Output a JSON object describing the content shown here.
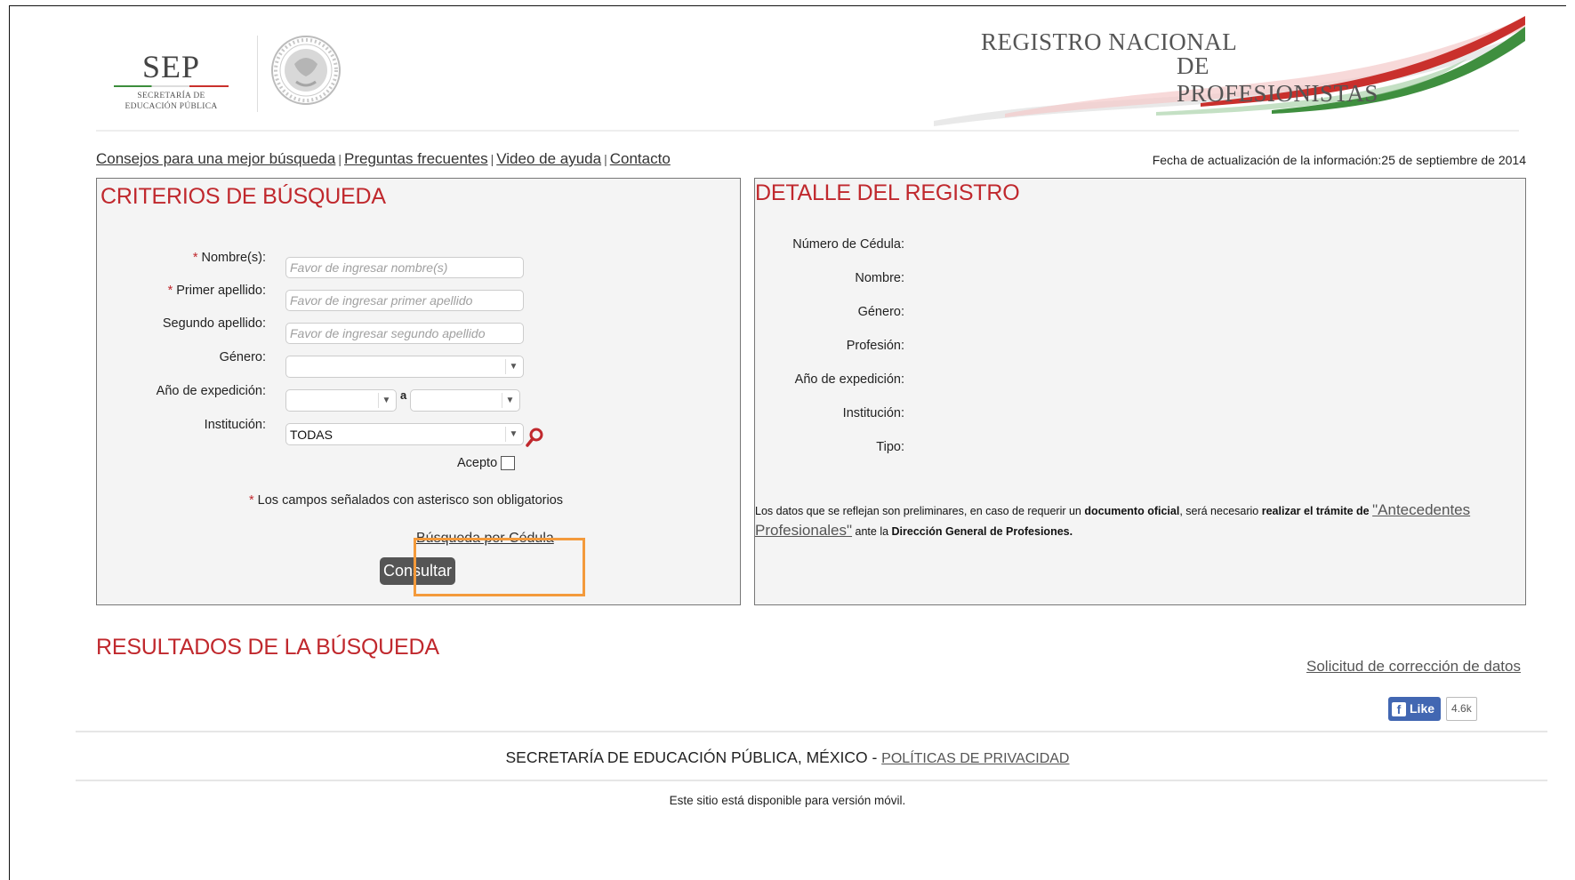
{
  "header": {
    "sep_logo": {
      "word": "SEP",
      "sub1": "SECRETARÍA DE",
      "sub2": "EDUCACIÓN PÚBLICA"
    },
    "title_line1": "REGISTRO NACIONAL",
    "title_line2": "DE PROFESIONISTAS"
  },
  "toplinks": [
    "Consejos para una mejor búsqueda",
    "Preguntas frecuentes",
    "Video de ayuda",
    "Contacto"
  ],
  "link_separator": "|",
  "fecha": "Fecha de actualización de la información:25 de septiembre de 2014",
  "search": {
    "title": "CRITERIOS DE BÚSQUEDA",
    "required_mark": "*",
    "nombre_label": "Nombre(s):",
    "nombre_placeholder": "Favor de ingresar nombre(s)",
    "primer_label": "Primer apellido:",
    "primer_placeholder": "Favor de ingresar primer apellido",
    "segundo_label": "Segundo apellido:",
    "segundo_placeholder": "Favor de ingresar segundo apellido",
    "genero_label": "Género:",
    "genero_value": "",
    "anio_label": "Año de expedición:",
    "anio_from": "",
    "anio_sep": "a",
    "anio_to": "",
    "institucion_label": "Institución:",
    "institucion_value": "TODAS",
    "acepto_label": "Acepto",
    "required_note": "Los campos señalados con asterisco son obligatorios",
    "cedula_link": "Búsqueda por Cédula",
    "submit": "Consultar"
  },
  "detail": {
    "title": "DETALLE DEL REGISTRO",
    "fields": [
      "Número de Cédula:",
      "Nombre:",
      "Género:",
      "Profesión:",
      "Año de expedición:",
      "Institución:",
      "Tipo:"
    ],
    "correction_link": "Solicitud de corrección de datos",
    "disclaimer": {
      "t1": "Los datos que se reflejan son preliminares, en caso de requerir un ",
      "b1": "documento oficial",
      "t2": ", será necesario ",
      "b2": "realizar el trámite de",
      "link": "\"Antecedentes Profesionales\"",
      "t3": " ante la ",
      "b3": "Dirección General de Profesiones."
    }
  },
  "results_title": "RESULTADOS DE LA BÚSQUEDA",
  "facebook": {
    "icon": "f",
    "like": "Like",
    "count": "4.6k"
  },
  "footer": {
    "text": "SECRETARÍA DE EDUCACIÓN PÚBLICA, MÉXICO - ",
    "privacy": "POLÍTICAS DE PRIVACIDAD",
    "mobile": "Este sitio está disponible para versión móvil."
  },
  "colors": {
    "accent": "#c0282d",
    "highlight": "#f39a3b",
    "facebook": "#4267b2",
    "button": "#555555"
  }
}
